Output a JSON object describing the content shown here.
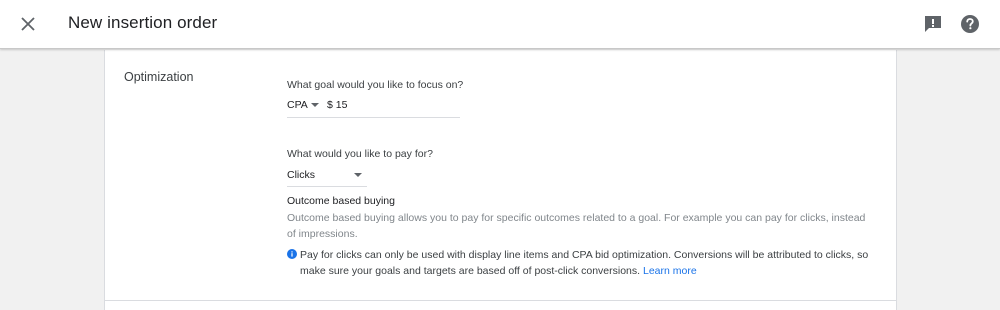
{
  "header": {
    "title": "New insertion order",
    "close_icon": "close-icon",
    "feedback_icon": "feedback-icon",
    "help_icon": "help-icon"
  },
  "optimization": {
    "section_label": "Optimization",
    "goal": {
      "question": "What goal would you like to focus on?",
      "selected": "CPA",
      "value": "$ 15"
    },
    "pay": {
      "question": "What would you like to pay for?",
      "selected": "Clicks"
    },
    "outcome": {
      "title": "Outcome based buying",
      "description": "Outcome based buying allows you to pay for specific outcomes related to a goal. For example you can pay for clicks, instead of impressions."
    },
    "notice": {
      "text": "Pay for clicks can only be used with display line items and CPA bid optimization. Conversions will be attributed to clicks, so make sure your goals and targets are based off of post-click conversions.",
      "link": "Learn more"
    }
  },
  "colors": {
    "accent": "#1a73e8",
    "background": "#f1f1f1"
  }
}
